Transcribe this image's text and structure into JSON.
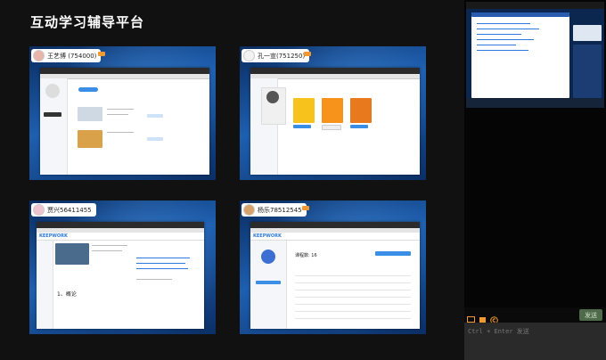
{
  "app": {
    "title": "互动学习辅导平台"
  },
  "tiles": [
    {
      "name": "王艺博 (754000)"
    },
    {
      "name": "孔一宣(751250)"
    },
    {
      "name": "贾兴56411455"
    },
    {
      "name": "杨乐78512545"
    }
  ],
  "tile3_ui": {
    "brand": "KEEPWORK",
    "heading": "1、概论"
  },
  "tile4_ui": {
    "brand": "KEEPWORK",
    "heading": "课程数: 16"
  },
  "chat": {
    "send_label": "发送",
    "input_placeholder": "Ctrl + Enter 发送"
  },
  "colors": {
    "accent": "#f29a32",
    "send_bg": "#4f6a4a",
    "tile_bg": "#1e5fb0"
  },
  "icons": [
    "screen-share-icon",
    "stop-icon",
    "copyright-icon"
  ]
}
